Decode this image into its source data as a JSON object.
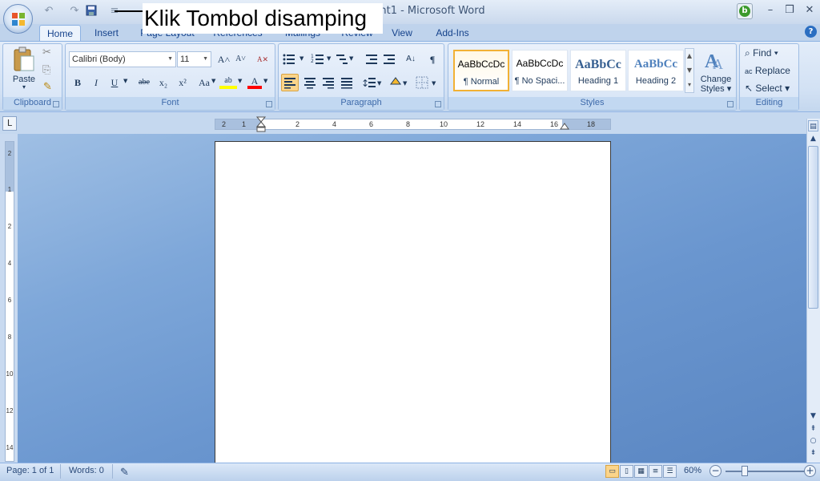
{
  "window": {
    "title_suffix": "nt1 - Microsoft Word",
    "minimize": "–",
    "restore": "❒",
    "close": "✕",
    "bing_glyph": "b"
  },
  "callout": {
    "text": "Klik Tombol disamping"
  },
  "quick_access": {
    "undo": "↶",
    "redo": "↷",
    "customize": "≡"
  },
  "tabs": [
    {
      "label": "Home"
    },
    {
      "label": "Insert"
    },
    {
      "label": "Page Layout"
    },
    {
      "label": "References"
    },
    {
      "label": "Mailings"
    },
    {
      "label": "Review"
    },
    {
      "label": "View"
    },
    {
      "label": "Add-Ins"
    }
  ],
  "ribbon": {
    "clipboard": {
      "label": "Clipboard",
      "paste": "Paste",
      "cut_glyph": "✂",
      "copy_glyph": "⎘",
      "painter_glyph": "✎"
    },
    "font": {
      "label": "Font",
      "family": "Calibri (Body)",
      "size": "11",
      "grow": "A˄",
      "shrink": "A˅",
      "clear": "A✕",
      "bold": "B",
      "italic": "I",
      "underline": "U",
      "strike": "abe",
      "subscript": "x₂",
      "superscript": "x²",
      "case": "Aa",
      "highlight": "ab",
      "color": "A"
    },
    "paragraph": {
      "label": "Paragraph",
      "pilcrow": "¶",
      "sort": "A↓"
    },
    "styles": {
      "label": "Styles",
      "items": [
        {
          "preview": "AaBbCcDc",
          "name": "¶ Normal"
        },
        {
          "preview": "AaBbCcDc",
          "name": "¶ No Spaci..."
        },
        {
          "preview": "AaBbCc",
          "name": "Heading 1"
        },
        {
          "preview": "AaBbCc",
          "name": "Heading 2"
        }
      ],
      "change": "Change",
      "change2": "Styles"
    },
    "editing": {
      "label": "Editing",
      "find": "Find",
      "replace": "Replace",
      "select": "Select"
    }
  },
  "ruler": {
    "h_ticks": [
      "2",
      "1",
      "2",
      "4",
      "6",
      "8",
      "10",
      "12",
      "14",
      "16",
      "18"
    ],
    "v_ticks": [
      "2",
      "1",
      "2",
      "4",
      "6",
      "8",
      "10",
      "12",
      "14"
    ],
    "tab_selector": "L"
  },
  "status": {
    "page": "Page: 1 of 1",
    "words": "Words: 0",
    "zoom": "60%",
    "zoom_out": "−",
    "zoom_in": "+"
  },
  "colors": {
    "accent": "#15428b",
    "highlight": "#ffff00",
    "font_color": "#ff0000",
    "workspace": "#6a96cf"
  }
}
